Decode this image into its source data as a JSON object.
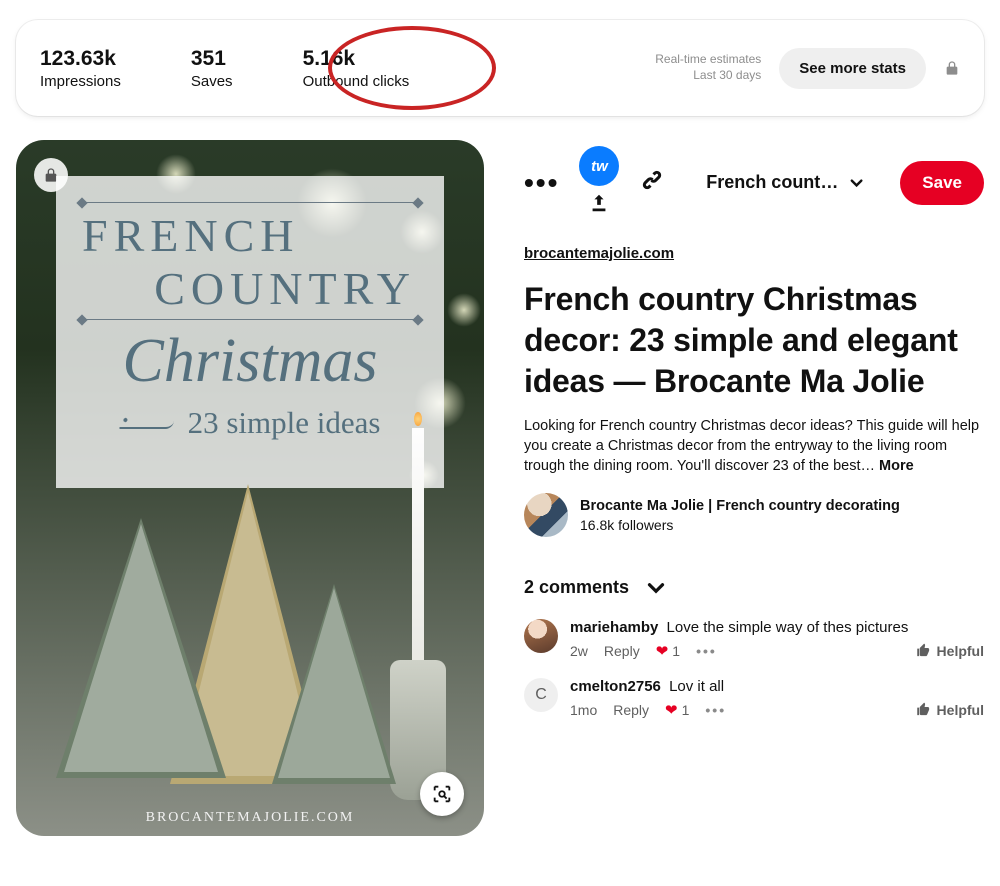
{
  "stats": {
    "impressions": {
      "value": "123.63k",
      "label": "Impressions"
    },
    "saves": {
      "value": "351",
      "label": "Saves"
    },
    "outbound": {
      "value": "5.16k",
      "label": "Outbound clicks"
    },
    "estimates_line1": "Real-time estimates",
    "estimates_line2": "Last 30 days",
    "see_more": "See more stats"
  },
  "pin_image": {
    "overlay_line1": "FRENCH",
    "overlay_line2": "COUNTRY",
    "overlay_script": "Christmas",
    "overlay_sub": "23 simple ideas",
    "watermark": "BROCANTEMAJOLIE.COM"
  },
  "actions": {
    "tw_badge": "tw",
    "board_label": "French countr…",
    "save": "Save"
  },
  "source_link": "brocantemajolie.com",
  "title": "French country Christmas decor: 23 simple and elegant ideas — Brocante Ma Jolie",
  "description": "Looking for French country Christmas decor ideas? This guide will help you create a Christmas decor from the entryway to the living room trough the dining room. You'll discover 23 of the best…",
  "more": "More",
  "author": {
    "name": "Brocante Ma Jolie | French country decorating",
    "followers": "16.8k followers"
  },
  "comments": {
    "header": "2 comments",
    "items": [
      {
        "user": "mariehamby",
        "text": "Love the simple way of thes pictures",
        "age": "2w",
        "likes": "1",
        "avatar": "a",
        "initial": ""
      },
      {
        "user": "cmelton2756",
        "text": "Lov it all",
        "age": "1mo",
        "likes": "1",
        "avatar": "b",
        "initial": "C"
      }
    ],
    "reply": "Reply",
    "helpful": "Helpful"
  }
}
